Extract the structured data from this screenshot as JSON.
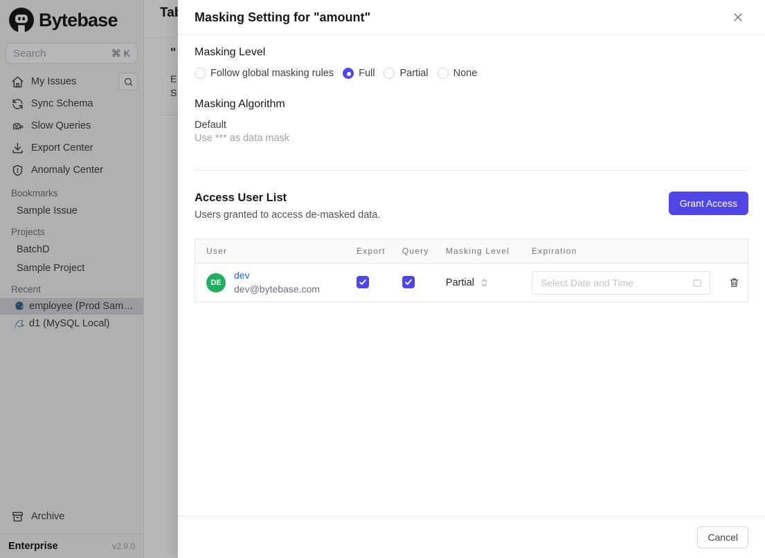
{
  "app": {
    "brand": "Bytebase",
    "plan": "Enterprise",
    "version": "v2.9.0"
  },
  "sidebar": {
    "search": {
      "placeholder": "Search",
      "shortcut": "⌘ K"
    },
    "nav": [
      {
        "label": "My Issues",
        "icon": "home-icon"
      },
      {
        "label": "Sync Schema",
        "icon": "sync-icon"
      },
      {
        "label": "Slow Queries",
        "icon": "turtle-icon"
      },
      {
        "label": "Export Center",
        "icon": "download-icon"
      },
      {
        "label": "Anomaly Center",
        "icon": "shield-icon"
      }
    ],
    "sections": [
      {
        "header": "Bookmarks",
        "items": [
          {
            "label": "Sample Issue"
          }
        ]
      },
      {
        "header": "Projects",
        "items": [
          {
            "label": "BatchD"
          },
          {
            "label": "Sample Project"
          }
        ]
      },
      {
        "header": "Recent",
        "items": [
          {
            "label": "employee (Prod Sam…",
            "icon": "postgres-icon",
            "selected": true
          },
          {
            "label": "d1 (MySQL Local)",
            "icon": "mysql-icon",
            "selected": false
          }
        ]
      }
    ],
    "archive_label": "Archive"
  },
  "background_page": {
    "title_fragment": "Tab",
    "fragment_quote": "\"",
    "fragment_e": "E",
    "fragment_s": "S"
  },
  "modal": {
    "title": "Masking Setting for \"amount\"",
    "masking_level": {
      "heading": "Masking Level",
      "options": [
        {
          "label": "Follow global masking rules",
          "selected": false
        },
        {
          "label": "Full",
          "selected": true
        },
        {
          "label": "Partial",
          "selected": false
        },
        {
          "label": "None",
          "selected": false
        }
      ]
    },
    "masking_algorithm": {
      "heading": "Masking Algorithm",
      "name": "Default",
      "description": "Use *** as data mask"
    },
    "access": {
      "heading": "Access User List",
      "subtitle": "Users granted to access de-masked data.",
      "grant_button": "Grant Access",
      "table": {
        "columns": {
          "user": "User",
          "export": "Export",
          "query": "Query",
          "masking_level": "Masking Level",
          "expiration": "Expiration"
        },
        "rows": [
          {
            "avatar_initials": "DE",
            "name": "dev",
            "email": "dev@bytebase.com",
            "export_checked": true,
            "query_checked": true,
            "masking_level": "Partial",
            "expiration_placeholder": "Select Date and Time"
          }
        ]
      }
    },
    "footer": {
      "cancel_label": "Cancel"
    }
  },
  "colors": {
    "accent": "#4f46e5",
    "link_blue": "#2563eb",
    "avatar_green": "#23ad61"
  }
}
